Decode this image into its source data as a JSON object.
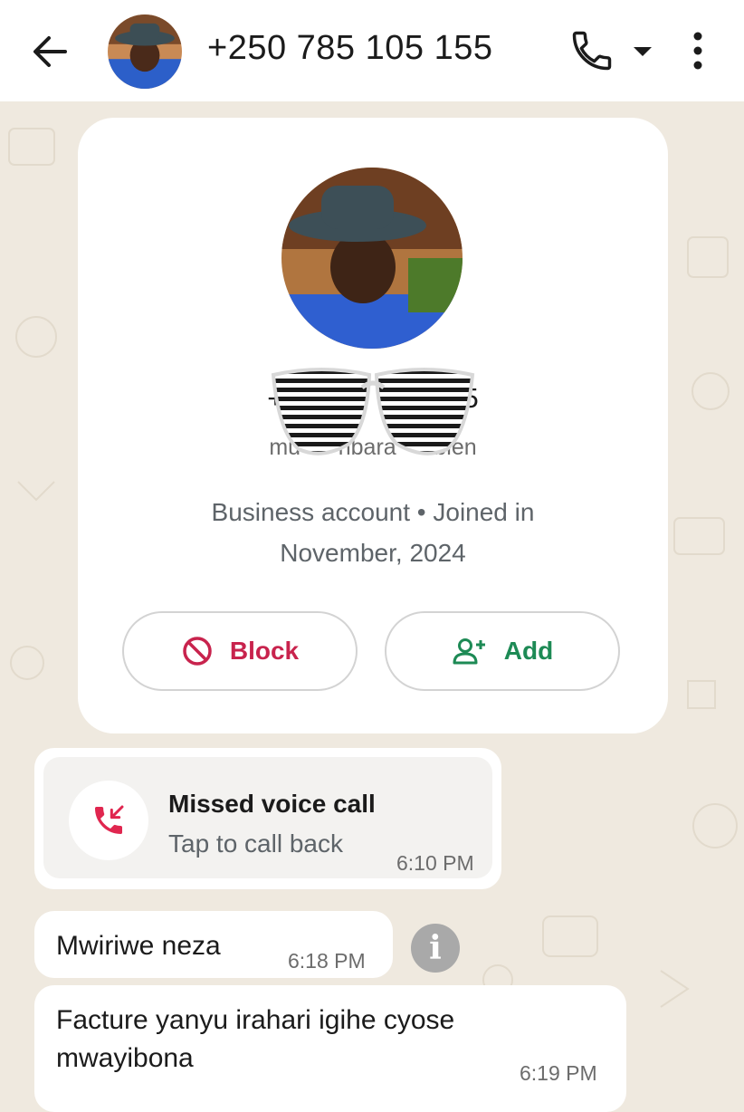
{
  "header": {
    "title": "+250 785 105 155",
    "icons": [
      "back-arrow-icon",
      "phone-icon",
      "chevron-down-icon",
      "more-vert-icon"
    ]
  },
  "profile": {
    "phone": "+2                 155",
    "username": "mu      nbara      bien",
    "info_line1": "Business account • Joined in",
    "info_line2": "November, 2024",
    "block_label": "Block",
    "add_label": "Add"
  },
  "messages": {
    "missed_call": {
      "title": "Missed voice call",
      "subtitle": "Tap to call back",
      "time": "6:10 PM"
    },
    "msg1": {
      "text": "Mwiriwe neza",
      "time": "6:18 PM"
    },
    "msg2": {
      "text": "Facture yanyu irahari igihe cyose mwayibona",
      "time": "6:19 PM"
    }
  },
  "colors": {
    "block": "#c8234d",
    "add": "#1d8a55",
    "background": "#efe9df"
  }
}
